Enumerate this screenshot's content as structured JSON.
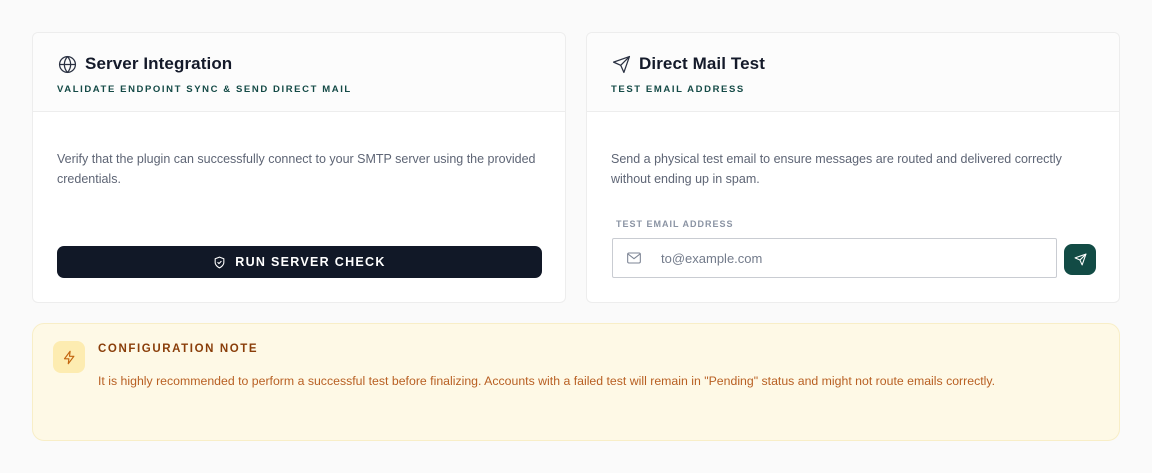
{
  "server_card": {
    "title": "Server Integration",
    "subtitle": "VALIDATE ENDPOINT SYNC & SEND DIRECT MAIL",
    "description": "Verify that the plugin can successfully connect to your SMTP server using the provided credentials.",
    "button_label": "RUN SERVER CHECK",
    "title_icon": "globe-icon",
    "button_icon": "shield-check-icon"
  },
  "mail_card": {
    "title": "Direct Mail Test",
    "subtitle": "TEST EMAIL ADDRESS",
    "description": "Send a physical test email to ensure messages are routed and delivered correctly without ending up in spam.",
    "field_label": "TEST EMAIL ADDRESS",
    "email_value": "",
    "email_placeholder": "to@example.com",
    "title_icon": "send-icon",
    "field_icon": "mail-icon",
    "send_icon": "send-icon"
  },
  "note": {
    "title": "CONFIGURATION NOTE",
    "text": "It is highly recommended to perform a successful test before finalizing. Accounts with a failed test will remain in \"Pending\" status and might not route emails correctly.",
    "icon": "lightning-icon"
  },
  "colors": {
    "primary_dark": "#111827",
    "accent_teal": "#124b45",
    "note_bg": "#fef9e6",
    "note_text": "#b85f22",
    "note_title": "#8a3e0a"
  }
}
